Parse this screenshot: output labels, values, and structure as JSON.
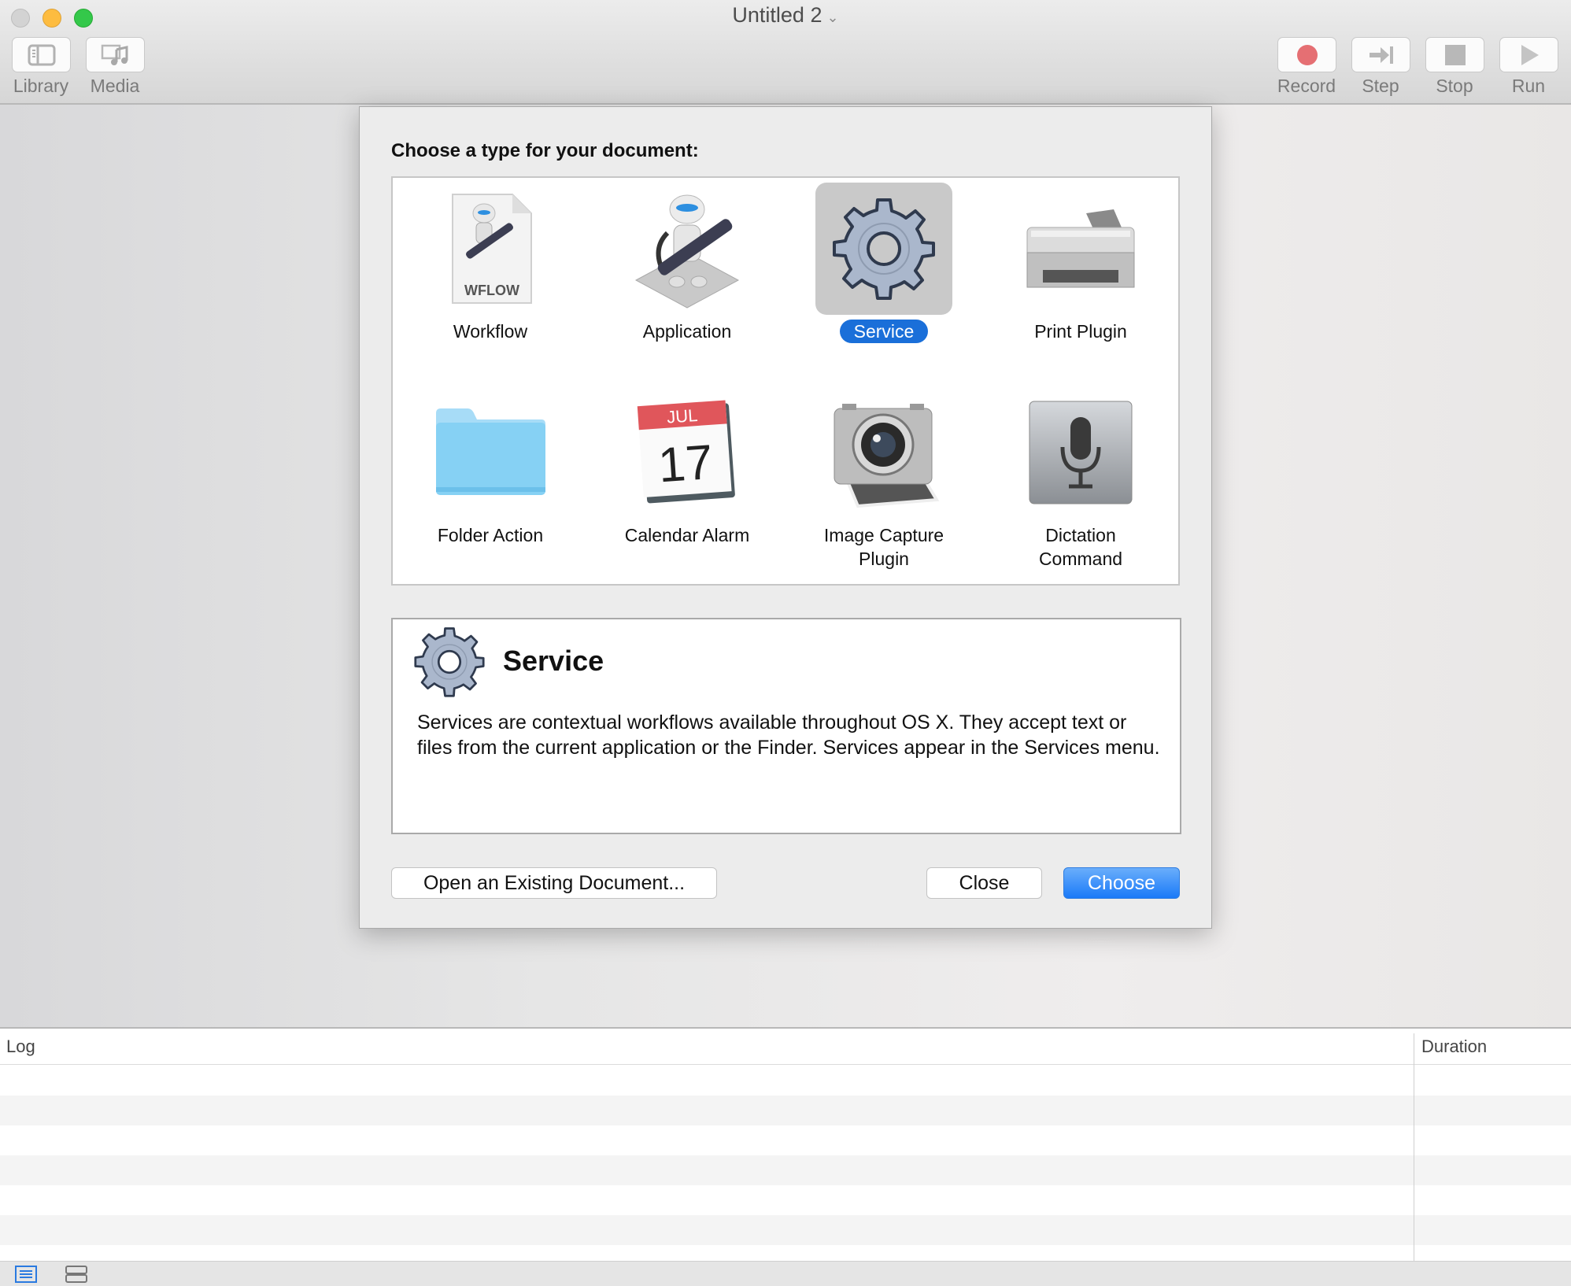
{
  "window": {
    "title": "Untitled 2",
    "title_chevron": "⌄"
  },
  "toolbar": {
    "left": [
      {
        "label": "Library",
        "icon": "library-sidebar-icon"
      },
      {
        "label": "Media",
        "icon": "media-icon"
      }
    ],
    "right": [
      {
        "label": "Record",
        "icon": "record-icon"
      },
      {
        "label": "Step",
        "icon": "step-icon"
      },
      {
        "label": "Stop",
        "icon": "stop-icon"
      },
      {
        "label": "Run",
        "icon": "run-icon"
      }
    ]
  },
  "dialog": {
    "heading": "Choose a type for your document:",
    "types": [
      {
        "label": "Workflow",
        "icon": "workflow-file-icon",
        "badge": "WFLOW",
        "selected": false
      },
      {
        "label": "Application",
        "icon": "automator-robot-icon",
        "selected": false
      },
      {
        "label": "Service",
        "icon": "gear-icon",
        "selected": true
      },
      {
        "label": "Print Plugin",
        "icon": "printer-icon",
        "selected": false
      },
      {
        "label": "Folder Action",
        "icon": "folder-icon",
        "selected": false
      },
      {
        "label": "Calendar Alarm",
        "icon": "calendar-icon",
        "month": "JUL",
        "day": "17",
        "selected": false
      },
      {
        "label": "Image Capture Plugin",
        "icon": "camera-icon",
        "selected": false
      },
      {
        "label": "Dictation Command",
        "icon": "microphone-icon",
        "selected": false
      }
    ],
    "description": {
      "title": "Service",
      "text": "Services are contextual workflows available throughout OS X. They accept text or files from the current application or the Finder. Services appear in the Services menu."
    },
    "buttons": {
      "open_existing": "Open an Existing Document...",
      "close": "Close",
      "choose": "Choose"
    }
  },
  "log": {
    "columns": [
      "Log",
      "Duration"
    ]
  },
  "colors": {
    "accent": "#1a6fd9",
    "choose_button": "#1a7af8",
    "record": "#e0565b"
  }
}
